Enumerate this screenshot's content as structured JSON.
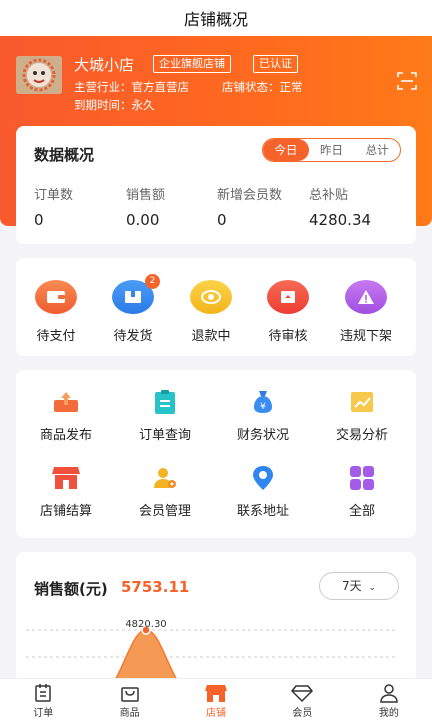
{
  "header": {
    "title": "店铺概况"
  },
  "shop": {
    "name": "大城小店",
    "tags": [
      "企业旗舰店铺",
      "已认证"
    ],
    "industry_label": "主营行业：",
    "industry_value": "官方直营店",
    "status_label": "店铺状态：",
    "status_value": "正常",
    "expiry_label": "到期时间：",
    "expiry_value": "永久"
  },
  "overview": {
    "title": "数据概况",
    "range_tabs": [
      "今日",
      "昨日",
      "总计"
    ],
    "active_range": "今日",
    "stats": [
      {
        "label": "订单数",
        "value": "0"
      },
      {
        "label": "销售额",
        "value": "0.00"
      },
      {
        "label": "新增会员数",
        "value": "0"
      },
      {
        "label": "总补贴",
        "value": "4280.34"
      }
    ]
  },
  "order_status": [
    {
      "label": "待支付",
      "icon": "wallet-icon",
      "color": "#f26c3b"
    },
    {
      "label": "待发货",
      "icon": "package-icon",
      "color": "#2f86f0",
      "badge": "2"
    },
    {
      "label": "退款中",
      "icon": "coin-icon",
      "color": "#f5bb1e"
    },
    {
      "label": "待审核",
      "icon": "review-icon",
      "color": "#f2503f"
    },
    {
      "label": "违规下架",
      "icon": "warning-icon",
      "color": "#b35ee8"
    }
  ],
  "tools": [
    {
      "label": "商品发布",
      "icon": "upload-icon"
    },
    {
      "label": "订单查询",
      "icon": "clipboard-icon"
    },
    {
      "label": "财务状况",
      "icon": "money-bag-icon"
    },
    {
      "label": "交易分析",
      "icon": "chart-icon"
    },
    {
      "label": "店铺结算",
      "icon": "store-icon"
    },
    {
      "label": "会员管理",
      "icon": "member-gear-icon"
    },
    {
      "label": "联系地址",
      "icon": "location-icon"
    },
    {
      "label": "全部",
      "icon": "grid-icon"
    }
  ],
  "sales": {
    "label": "销售额(元)",
    "value": "5753.11",
    "range": "7天"
  },
  "chart_data": {
    "type": "area",
    "values": [
      4820.3
    ],
    "data_labels": [
      "4820.30"
    ],
    "grid": true
  },
  "tabbar": [
    {
      "label": "订单",
      "icon": "orders-icon"
    },
    {
      "label": "商品",
      "icon": "bag-icon"
    },
    {
      "label": "店铺",
      "icon": "shop-icon",
      "active": true
    },
    {
      "label": "会员",
      "icon": "diamond-icon"
    },
    {
      "label": "我的",
      "icon": "user-icon"
    }
  ],
  "colors": {
    "accent": "#f5622a"
  }
}
